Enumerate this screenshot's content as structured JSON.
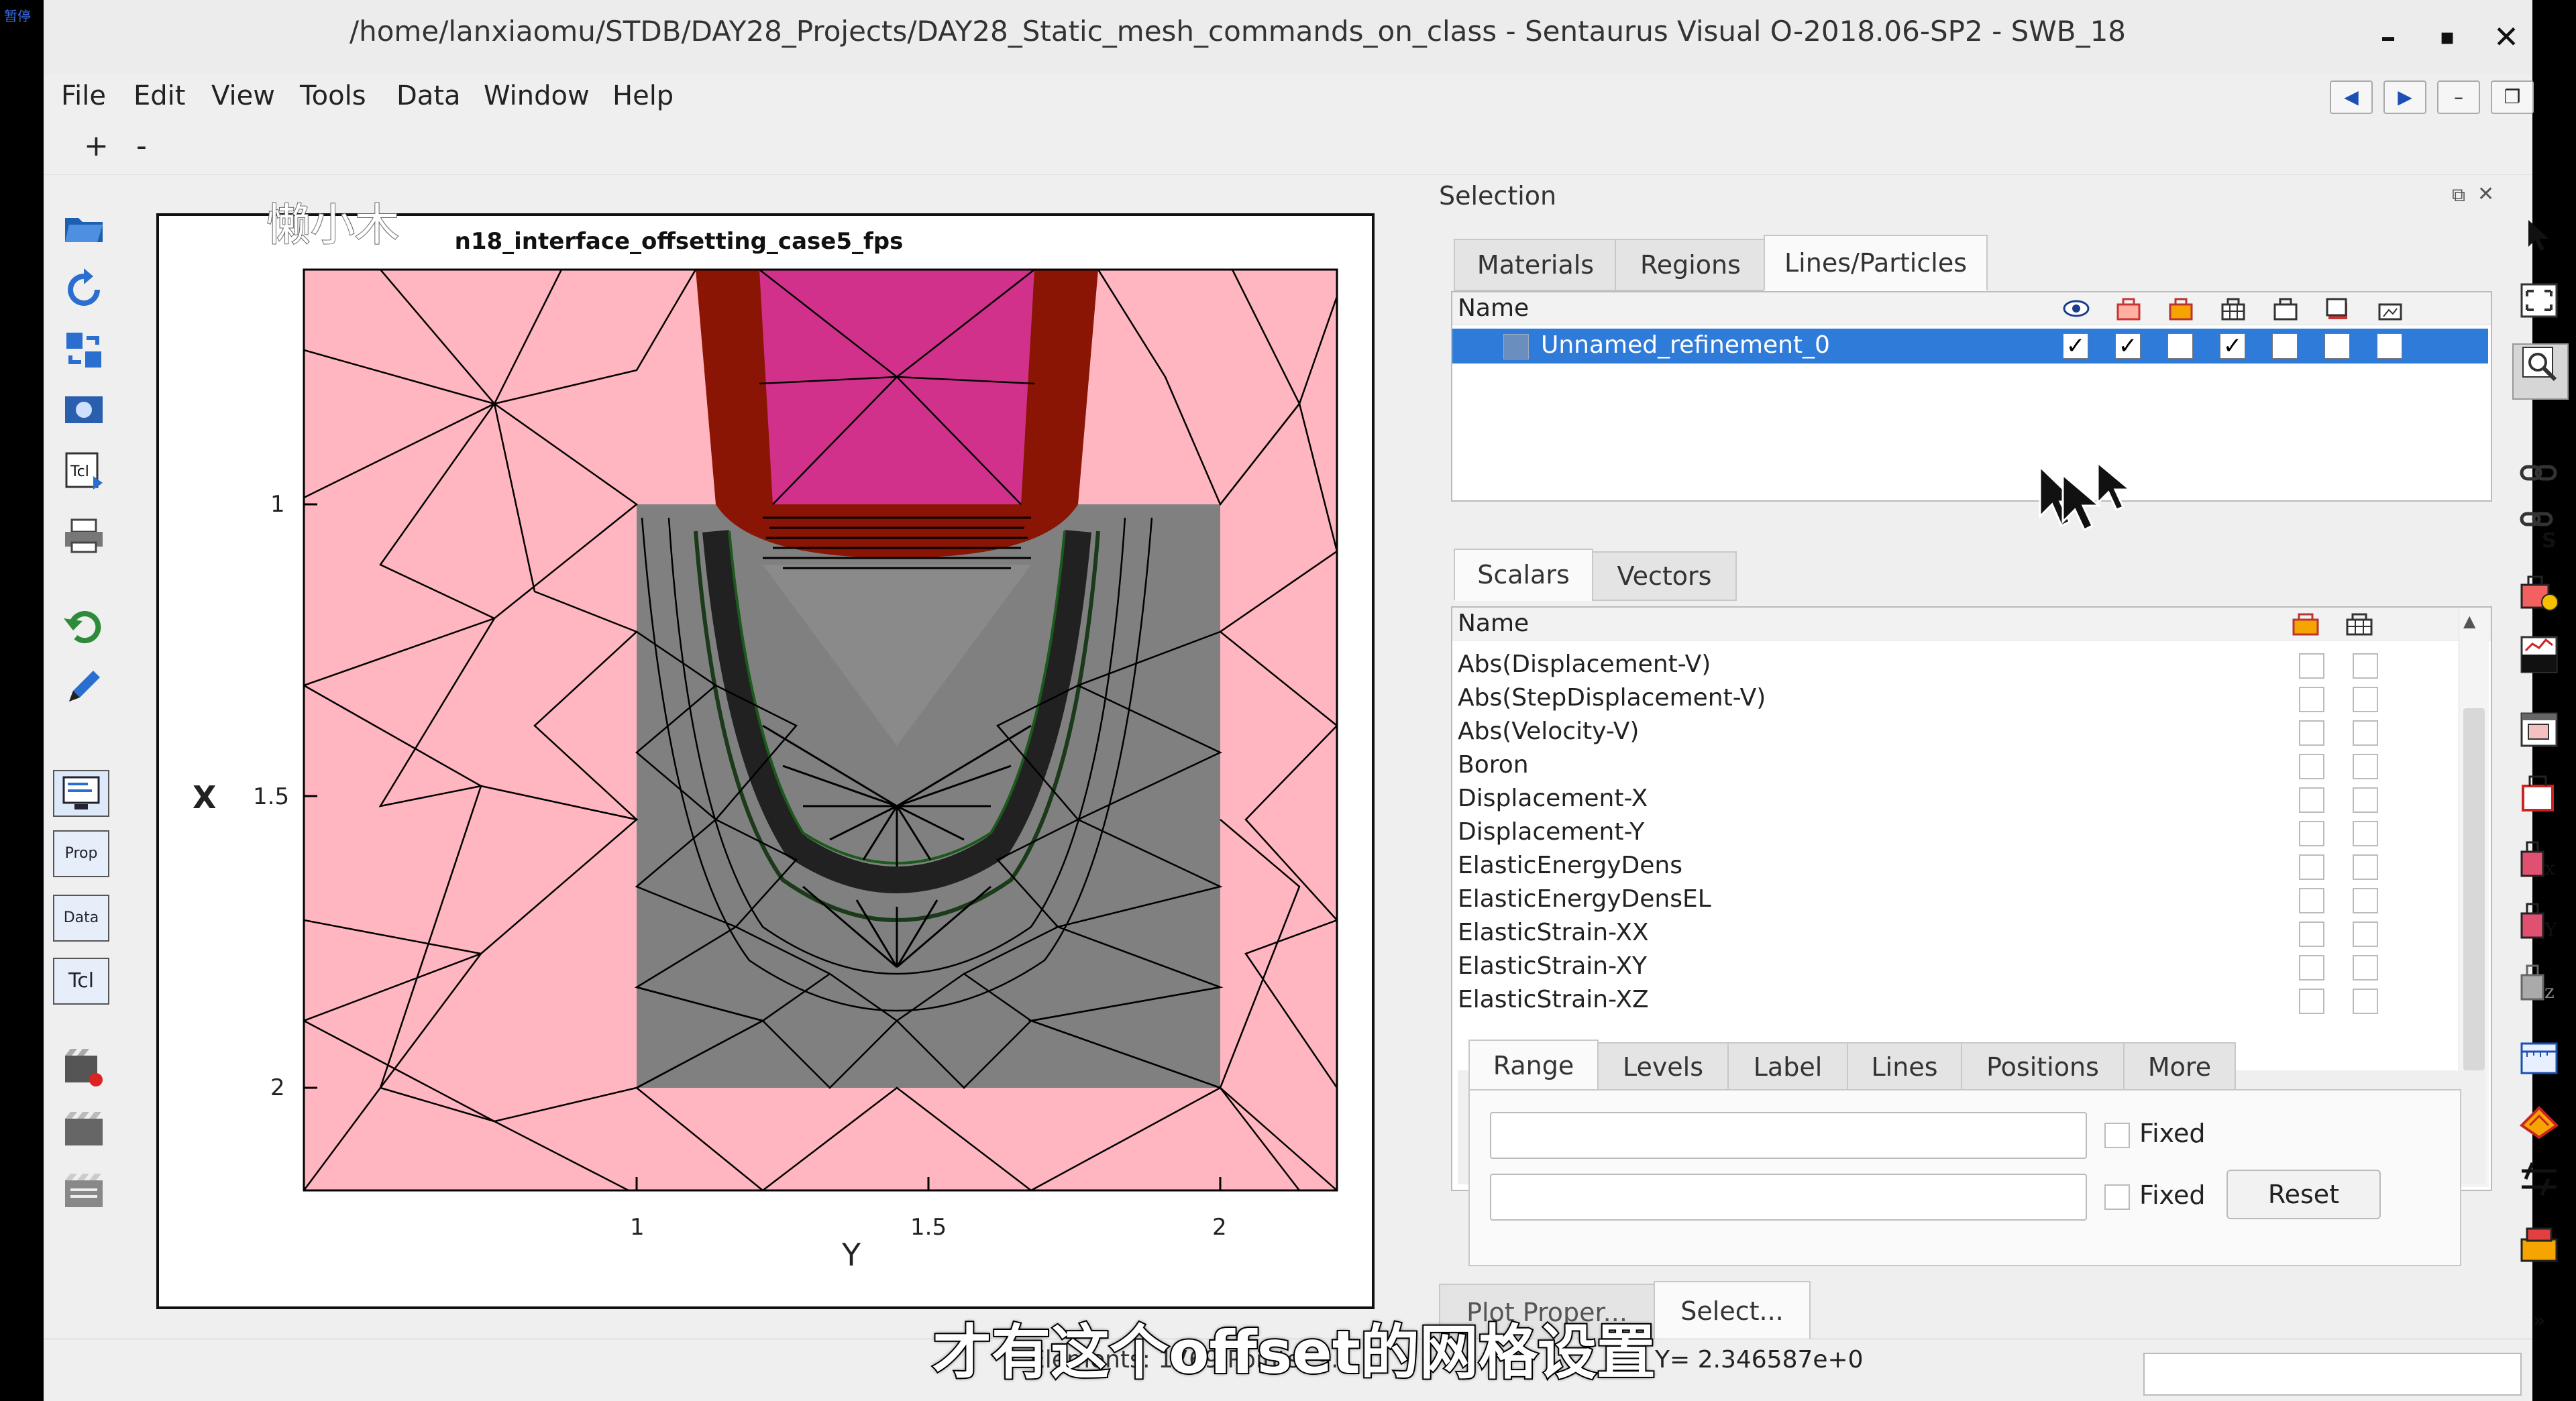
{
  "corner_badge": "暂停",
  "window": {
    "title": "/home/lanxiaomu/STDB/DAY28_Projects/DAY28_Static_mesh_commands_on_class - Sentaurus Visual O-2018.06-SP2 - SWB_18",
    "controls": [
      "–",
      "▪",
      "✕"
    ]
  },
  "menu": [
    "File",
    "Edit",
    "View",
    "Tools",
    "Data",
    "Window",
    "Help"
  ],
  "menu_nav": {
    "prev": "◀",
    "next": "▶",
    "minimize": "–",
    "restore": "❐"
  },
  "zoom": {
    "plus": "+",
    "minus": "-"
  },
  "left_toolbar": {
    "icons": [
      "open-folder-icon",
      "reload-icon",
      "sync-icon",
      "snapshot-icon",
      "tcl-script-icon",
      "print-icon",
      "undo-icon",
      "draw-icon",
      "console-icon",
      "prop-icon",
      "data-icon",
      "tcl-icon",
      "movie-record-icon",
      "movie-icon",
      "movie-edit-icon"
    ],
    "prop_label": "Prop",
    "data_label": "Data",
    "tcl_label": "Tcl"
  },
  "plot": {
    "watermark": "懒小木",
    "title": "n18_interface_offsetting_case5_fps",
    "x_axis_label": "X",
    "y_axis_label": "Y",
    "x_ticks": [
      "1",
      "1.5",
      "2"
    ],
    "y_ticks": [
      "1",
      "1.5",
      "2"
    ],
    "colors": {
      "oxide": "#ffb6c1",
      "poly": "#d2318b",
      "spacer": "#8b1505",
      "silicon": "#808080",
      "mesh": "#000000"
    }
  },
  "selection": {
    "title": "Selection",
    "top_tabs": [
      "Materials",
      "Regions",
      "Lines/Particles"
    ],
    "active_top_tab": "Lines/Particles",
    "lines_header": "Name",
    "lines_rows": [
      {
        "name": "Unnamed_refinement_0",
        "checks": [
          true,
          true,
          false,
          true,
          false,
          false,
          false
        ]
      }
    ],
    "scalar_tabs": [
      "Scalars",
      "Vectors"
    ],
    "active_scalar_tab": "Scalars",
    "scalars_header": "Name",
    "scalars": [
      "Abs(Displacement-V)",
      "Abs(StepDisplacement-V)",
      "Abs(Velocity-V)",
      "Boron",
      "Displacement-X",
      "Displacement-Y",
      "ElasticEnergyDens",
      "ElasticEnergyDensEL",
      "ElasticStrain-XX",
      "ElasticStrain-XY",
      "ElasticStrain-XZ"
    ],
    "range_tabs": [
      "Range",
      "Levels",
      "Label",
      "Lines",
      "Positions",
      "More"
    ],
    "active_range_tab": "Range",
    "fixed_label": "Fixed",
    "reset_label": "Reset"
  },
  "bottom_tabs": [
    "Plot Proper...",
    "Select..."
  ],
  "status": {
    "left": "Elements: 1769  Points: 9...",
    "right": "Y= 2.346587e+0"
  },
  "subtitle": "才有这个offset的网格设置"
}
